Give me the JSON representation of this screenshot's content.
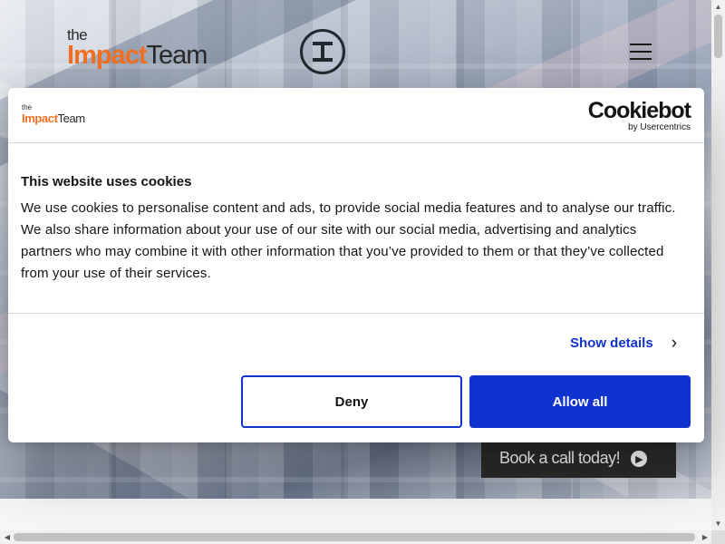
{
  "site": {
    "logo": {
      "the": "the",
      "impact": "Impact",
      "team": "Team"
    },
    "cta_label": "Book a call today!"
  },
  "icons": {
    "emblem": "impact-team-emblem-icon",
    "menu": "hamburger-menu-icon",
    "cta_arrow": "arrow-right-circle-icon",
    "show_details": "chevron-right-icon"
  },
  "cookie_dialog": {
    "logo": {
      "the": "the",
      "impact": "Impact",
      "team": "Team"
    },
    "provider": {
      "name": "Cookiebot",
      "by": "by Usercentrics"
    },
    "title": "This website uses cookies",
    "body": "We use cookies to personalise content and ads, to provide social media features and to analyse our traffic. We also share information about your use of our site with our social media, advertising and analytics partners who may combine it with other information that you’ve provided to them or that they’ve collected from your use of their services.",
    "show_details_label": "Show details",
    "deny_label": "Deny",
    "allow_all_label": "Allow all"
  },
  "colors": {
    "brand_orange": "#f26f21",
    "accent_blue": "#1032cf",
    "dark_text": "#141414"
  }
}
